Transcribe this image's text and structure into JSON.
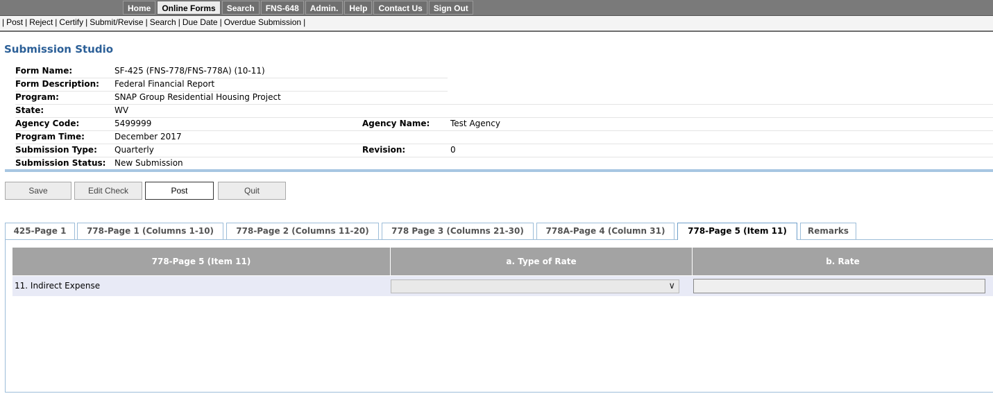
{
  "top_menu": [
    "Home",
    "Online Forms",
    "Search",
    "FNS-648",
    "Admin.",
    "Help",
    "Contact Us",
    "Sign Out"
  ],
  "top_menu_active": "Online Forms",
  "sub_menu": [
    "Post",
    "Reject",
    "Certify",
    "Submit/Revise",
    "Search",
    "Due Date",
    "Overdue Submission"
  ],
  "page_title": "Submission Studio",
  "info": {
    "form_name_label": "Form Name:",
    "form_name": "SF-425 (FNS-778/FNS-778A) (10-11)",
    "form_desc_label": "Form Description:",
    "form_desc": "Federal Financial Report",
    "program_label": "Program:",
    "program": "SNAP Group Residential Housing Project",
    "state_label": "State:",
    "state": "WV",
    "agency_code_label": "Agency Code:",
    "agency_code": "5499999",
    "agency_name_label": "Agency Name:",
    "agency_name": "Test Agency",
    "program_time_label": "Program Time:",
    "program_time": "December 2017",
    "submission_type_label": "Submission Type:",
    "submission_type": "Quarterly",
    "revision_label": "Revision:",
    "revision": "0",
    "submission_status_label": "Submission Status:",
    "submission_status": "New Submission"
  },
  "buttons": {
    "save": "Save",
    "edit_check": "Edit Check",
    "post": "Post",
    "quit": "Quit"
  },
  "tabs": [
    "425-Page 1",
    "778-Page 1 (Columns 1-10)",
    "778-Page 2 (Columns 11-20)",
    "778 Page 3 (Columns 21-30)",
    "778A-Page 4 (Column 31)",
    "778-Page 5 (Item 11)",
    "Remarks"
  ],
  "active_tab": "778-Page 5 (Item 11)",
  "grid": {
    "headers": [
      "778-Page 5 (Item 11)",
      "a. Type of Rate",
      "b. Rate"
    ],
    "row_label": "11. Indirect Expense",
    "type_of_rate": "",
    "rate": ""
  },
  "colors": {
    "title": "#2b5f97",
    "grid_header": "#a3a3a3",
    "row_highlight": "#e8eaf6",
    "tab_border": "#9cbdd9"
  }
}
